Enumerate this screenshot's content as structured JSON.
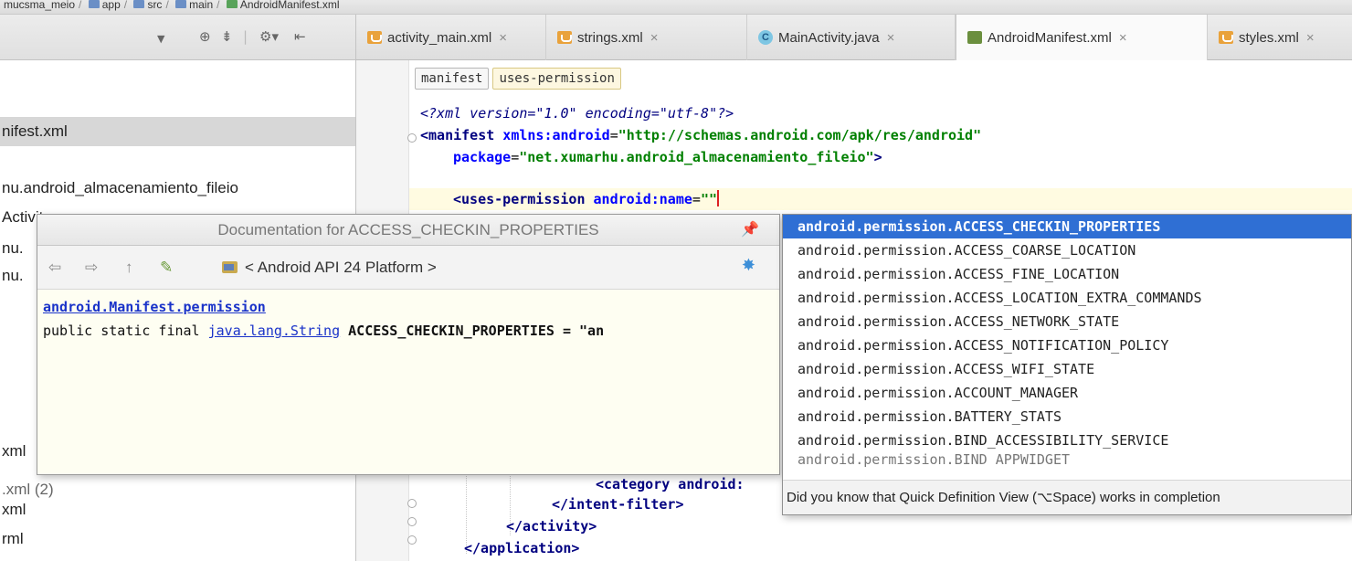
{
  "breadcrumb": {
    "items": [
      "mucsma_meio",
      "app",
      "src",
      "main",
      "AndroidManifest.xml"
    ]
  },
  "left_toolbar": {
    "icons": [
      "chevron-down",
      "target",
      "split",
      "gear-menu",
      "collapse"
    ]
  },
  "tabs": [
    {
      "label": "activity_main.xml",
      "icon": "xml",
      "active": false
    },
    {
      "label": "strings.xml",
      "icon": "xml",
      "active": false
    },
    {
      "label": "MainActivity.java",
      "icon": "java",
      "active": false
    },
    {
      "label": "AndroidManifest.xml",
      "icon": "manifest",
      "active": true
    },
    {
      "label": "styles.xml",
      "icon": "xml",
      "active": false
    }
  ],
  "tab_close": "×",
  "project_tree": {
    "rows": [
      {
        "label": "nifest.xml",
        "selected": true
      },
      {
        "label": "nu.android_almacenamiento_fileio",
        "selected": false
      },
      {
        "label": "Activity",
        "selected": false
      },
      {
        "label": "nu.",
        "selected": false
      },
      {
        "label": "nu.",
        "selected": false
      },
      {
        "label": "xml",
        "selected": false
      },
      {
        "label": ".xml (2)",
        "selected": false
      },
      {
        "label": "xml",
        "selected": false
      },
      {
        "label": "rml",
        "selected": false
      }
    ]
  },
  "editor": {
    "crumbs": [
      "manifest",
      "uses-permission"
    ],
    "code": {
      "line1_pi": "<?xml version=\"1.0\" encoding=\"utf-8\"?>",
      "line2_tag": "<manifest",
      "line2_attr": " xmlns:android",
      "line2_eq": "=",
      "line2_val": "\"http://schemas.android.com/apk/res/android\"",
      "line3_attr": "package",
      "line3_eq": "=",
      "line3_val": "\"net.xumarhu.android_almacenamiento_fileio\"",
      "line3_close": ">",
      "line5_tag": "<uses-permission",
      "line5_attr": " android:name",
      "line5_eq": "=",
      "line5_val": "\"\"",
      "line_category": "<category android:",
      "line_intent": "</intent-filter>",
      "line_activity": "</activity>",
      "line_application": "</application>"
    }
  },
  "doc_popup": {
    "title": "Documentation for ACCESS_CHECKIN_PROPERTIES",
    "api_label": "< Android API 24 Platform >",
    "class_link": "android.Manifest.permission",
    "sig_prefix": "public static final ",
    "sig_type": "java.lang.String",
    "sig_name": " ACCESS_CHECKIN_PROPERTIES",
    "sig_suffix": " = \"an",
    "nav_icons": [
      "back-arrow-icon",
      "forward-arrow-icon",
      "up-arrow-icon",
      "edit-source-icon"
    ],
    "pin_icon": "pin-icon",
    "settings_icon": "gear-icon"
  },
  "completion": {
    "items": [
      {
        "label": "android.permission.ACCESS_CHECKIN_PROPERTIES",
        "selected": true
      },
      {
        "label": "android.permission.ACCESS_COARSE_LOCATION",
        "selected": false
      },
      {
        "label": "android.permission.ACCESS_FINE_LOCATION",
        "selected": false
      },
      {
        "label": "android.permission.ACCESS_LOCATION_EXTRA_COMMANDS",
        "selected": false
      },
      {
        "label": "android.permission.ACCESS_NETWORK_STATE",
        "selected": false
      },
      {
        "label": "android.permission.ACCESS_NOTIFICATION_POLICY",
        "selected": false
      },
      {
        "label": "android.permission.ACCESS_WIFI_STATE",
        "selected": false
      },
      {
        "label": "android.permission.ACCOUNT_MANAGER",
        "selected": false
      },
      {
        "label": "android.permission.BATTERY_STATS",
        "selected": false
      },
      {
        "label": "android.permission.BIND_ACCESSIBILITY_SERVICE",
        "selected": false
      },
      {
        "label": "android.permission.BIND_APPWIDGET",
        "selected": false
      }
    ],
    "hint": "Did you know that Quick Definition View (⌥Space) works in completion"
  },
  "colors": {
    "selection_blue": "#2f6fd4",
    "current_line": "#fffbe1",
    "xml_tag": "#000080",
    "xml_attr": "#0000ff",
    "xml_value": "#008000",
    "link": "#1a33c9"
  }
}
